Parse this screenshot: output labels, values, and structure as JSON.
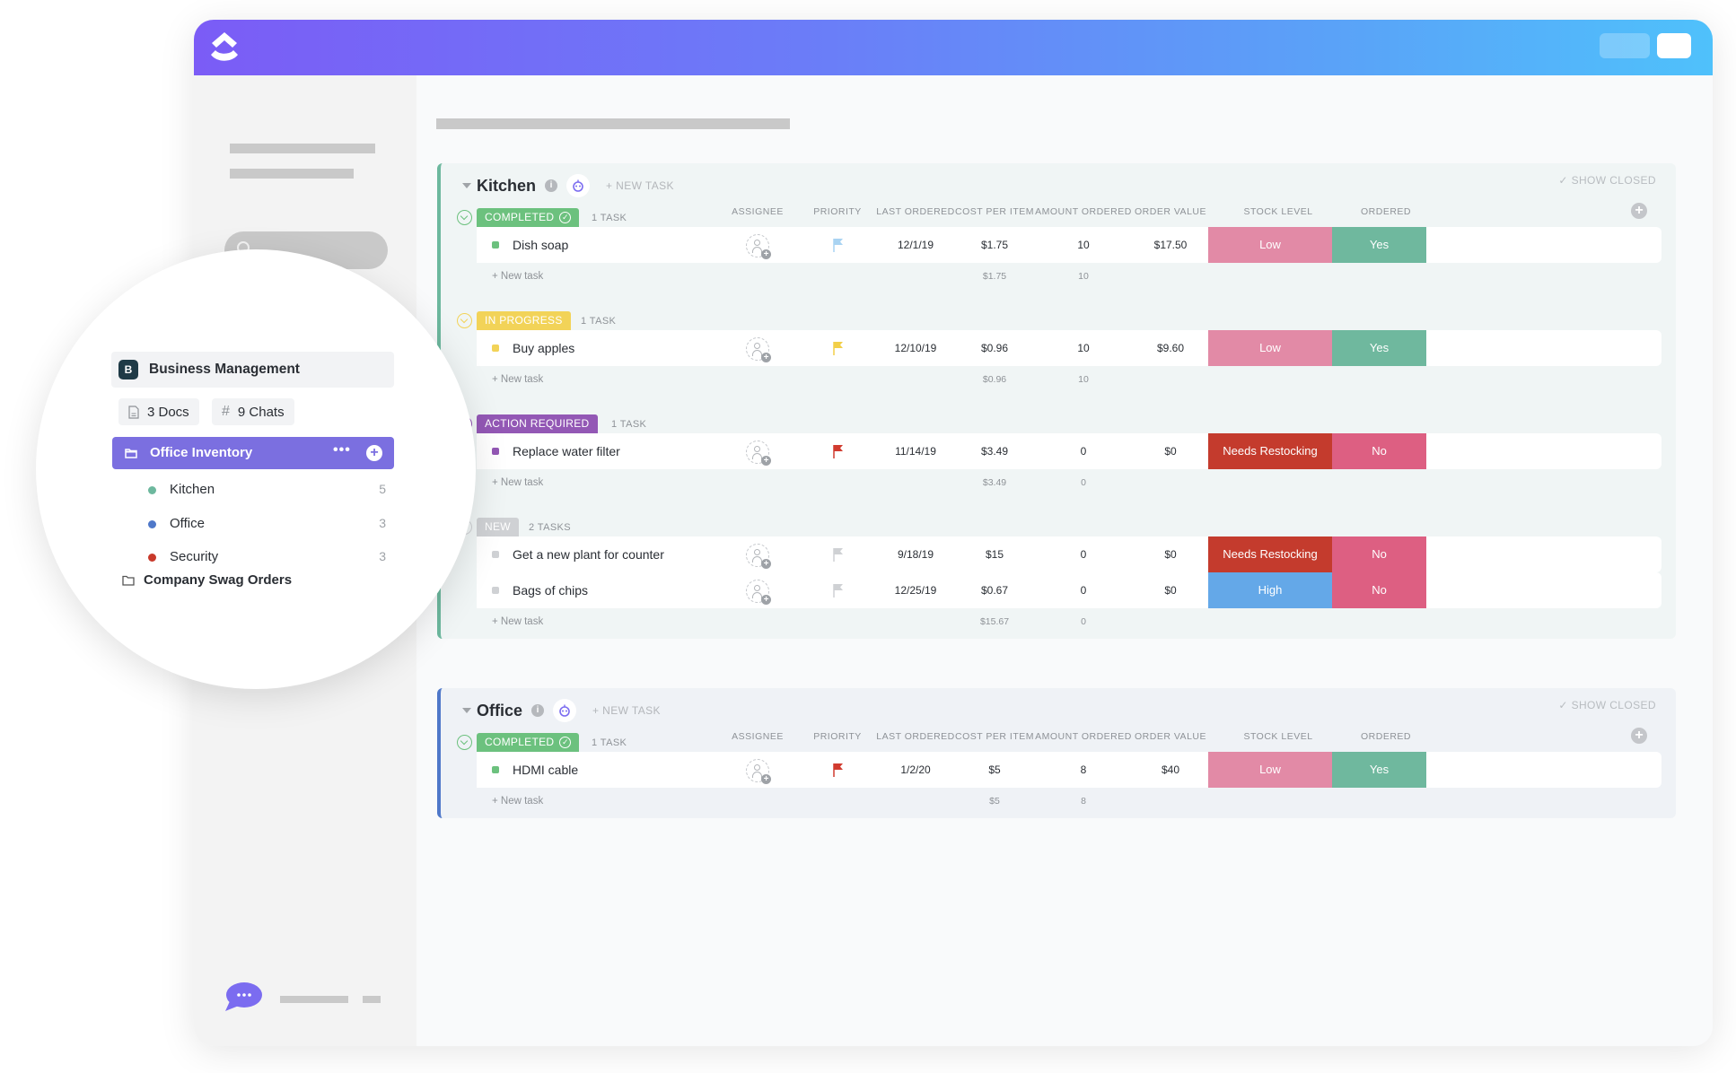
{
  "app": {
    "logo": "clickup-logo-icon",
    "brand_gradient": [
      "#7b5cf6",
      "#4fc1fb"
    ]
  },
  "sidebar_zoom": {
    "workspace": {
      "avatar_letter": "B",
      "name": "Business Management"
    },
    "chips": [
      {
        "icon": "doc-icon",
        "label": "3 Docs"
      },
      {
        "icon": "hash-icon",
        "label": "9 Chats",
        "glyph": "#"
      }
    ],
    "active_folder": {
      "label": "Office Inventory",
      "more": "•••",
      "add": "+"
    },
    "lists": [
      {
        "label": "Kitchen",
        "count": "5",
        "color": "#6db89e"
      },
      {
        "label": "Office",
        "count": "3",
        "color": "#4f78c9"
      },
      {
        "label": "Security",
        "count": "3",
        "color": "#c8392b"
      }
    ],
    "other_folder": {
      "label": "Company Swag Orders"
    }
  },
  "columns": [
    "ASSIGNEE",
    "PRIORITY",
    "LAST ORDERED",
    "COST PER ITEM",
    "AMOUNT ORDERED",
    "ORDER VALUE",
    "STOCK LEVEL",
    "ORDERED"
  ],
  "section_labels": {
    "new_task": "+ NEW TASK",
    "show_closed": "✓ SHOW CLOSED",
    "row_new_task": "+ New task"
  },
  "colors": {
    "completed": "#6cc17e",
    "in_progress": "#f2d358",
    "action_required": "#9358b5",
    "new": "#cfd1d4",
    "stock_low": "#e28aa6",
    "stock_needs_restocking": "#c43b2d",
    "stock_high": "#64a8e8",
    "ordered_yes": "#6fb89e",
    "ordered_no": "#dd5f82"
  },
  "sections": [
    {
      "title": "Kitchen",
      "groups": [
        {
          "status": "COMPLETED",
          "check": "✓",
          "count": "1 TASK",
          "tasks": [
            {
              "name": "Dish soap",
              "priority": "low",
              "last_ordered": "12/1/19",
              "cost": "$1.75",
              "amount": "10",
              "value": "$17.50",
              "stock": "Low",
              "ordered": "Yes"
            }
          ],
          "sum_cost": "$1.75",
          "sum_amount": "10"
        },
        {
          "status": "IN PROGRESS",
          "count": "1 TASK",
          "tasks": [
            {
              "name": "Buy apples",
              "priority": "normal",
              "last_ordered": "12/10/19",
              "cost": "$0.96",
              "amount": "10",
              "value": "$9.60",
              "stock": "Low",
              "ordered": "Yes"
            }
          ],
          "sum_cost": "$0.96",
          "sum_amount": "10"
        },
        {
          "status": "ACTION REQUIRED",
          "count": "1 TASK",
          "tasks": [
            {
              "name": "Replace water filter",
              "priority": "urgent",
              "last_ordered": "11/14/19",
              "cost": "$3.49",
              "amount": "0",
              "value": "$0",
              "stock": "Needs Restocking",
              "ordered": "No"
            }
          ],
          "sum_cost": "$3.49",
          "sum_amount": "0"
        },
        {
          "status": "NEW",
          "count": "2 TASKS",
          "tasks": [
            {
              "name": "Get a new plant for counter",
              "priority": "none",
              "last_ordered": "9/18/19",
              "cost": "$15",
              "amount": "0",
              "value": "$0",
              "stock": "Needs Restocking",
              "ordered": "No"
            },
            {
              "name": "Bags of chips",
              "priority": "none",
              "last_ordered": "12/25/19",
              "cost": "$0.67",
              "amount": "0",
              "value": "$0",
              "stock": "High",
              "ordered": "No"
            }
          ],
          "sum_cost": "$15.67",
          "sum_amount": "0"
        }
      ]
    },
    {
      "title": "Office",
      "groups": [
        {
          "status": "COMPLETED",
          "check": "✓",
          "count": "1 TASK",
          "tasks": [
            {
              "name": "HDMI cable",
              "priority": "urgent",
              "last_ordered": "1/2/20",
              "cost": "$5",
              "amount": "8",
              "value": "$40",
              "stock": "Low",
              "ordered": "Yes"
            }
          ],
          "sum_cost": "$5",
          "sum_amount": "8"
        }
      ]
    }
  ],
  "chat": {
    "icon": "chat-bubble-icon",
    "glyph": "•••"
  }
}
